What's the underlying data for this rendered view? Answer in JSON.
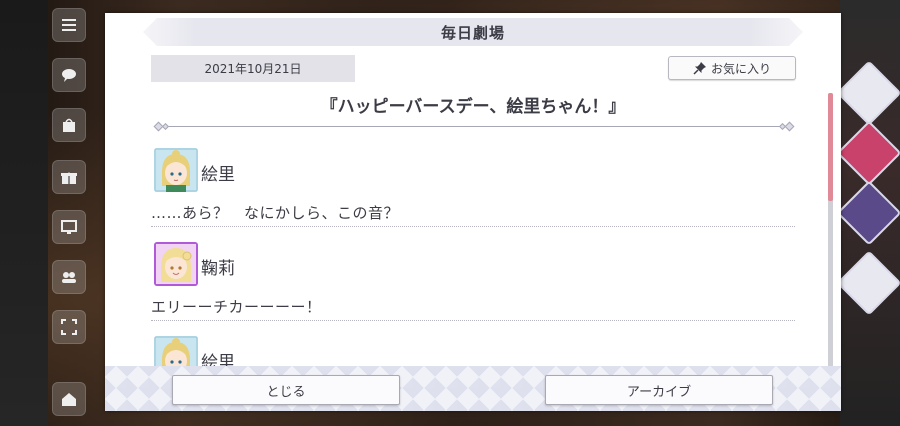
{
  "status_bar": {
    "time_hint": ""
  },
  "dialog": {
    "title": "毎日劇場",
    "date": "2021年10月21日",
    "favorite_label": "お気に入り",
    "story_title": "『ハッピーバースデー、絵里ちゃん！』",
    "scroll_position": 0.0,
    "entries": [
      {
        "speaker": "絵里",
        "line": "……あら？　なにかしら、この音？",
        "avatar": "eri-avatar"
      },
      {
        "speaker": "鞠莉",
        "line": "エリーーチカーーーー！",
        "avatar": "mari-avatar"
      },
      {
        "speaker": "絵里",
        "line": "",
        "avatar": "eri-avatar"
      }
    ],
    "close_label": "とじる",
    "archive_label": "アーカイブ"
  },
  "colors": {
    "scroll_thumb": "#e08a98",
    "eri_avatar_bg": "#c9e6f0",
    "mari_avatar_border": "#b05ad8"
  }
}
